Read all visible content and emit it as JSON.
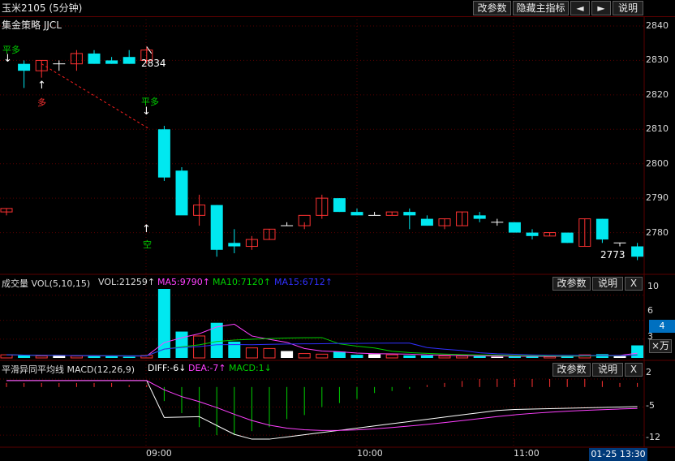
{
  "window": {
    "title": "玉米2105 (5分钟)",
    "buttons": {
      "change_params": "改参数",
      "hide_main": "隐藏主指标",
      "left": "◄",
      "right": "►",
      "help": "说明"
    }
  },
  "main_panel": {
    "strategy": "集金策略 JJCL",
    "y_ticks": [
      "2840",
      "2830",
      "2820",
      "2810",
      "2800",
      "2790",
      "2780"
    ],
    "annotations": {
      "sig1_label": "平多",
      "sig1_arrow": "↓",
      "sig2_label": "多",
      "sig2_arrow": "↑",
      "sig3_label": "平多",
      "sig3_arrow": "↓",
      "sig4_label": "空",
      "sig4_arrow": "↑",
      "high_price": "2834",
      "low_price": "2773"
    }
  },
  "volume_panel": {
    "title": "成交量 VOL(5,10,15)",
    "vol": "VOL:21259↑",
    "ma5": "MA5:9790↑",
    "ma10": "MA10:7120↑",
    "ma15": "MA15:6712↑",
    "y_ticks": [
      "10",
      "6",
      "3"
    ],
    "current": "4",
    "unit_btn": "×万",
    "buttons": {
      "change_params": "改参数",
      "help": "说明",
      "close": "X"
    }
  },
  "macd_panel": {
    "title": "平滑异同平均线 MACD(12,26,9)",
    "diff": "DIFF:-6↓",
    "dea": "DEA:-7↑",
    "macd": "MACD:1↓",
    "y_ticks": [
      "2",
      "-5",
      "-12"
    ],
    "buttons": {
      "change_params": "改参数",
      "help": "说明",
      "close": "X"
    }
  },
  "time_axis": {
    "labels": [
      "09:00",
      "10:00",
      "11:00"
    ],
    "current": "01-25 13:30"
  },
  "colors": {
    "up": "#ff3232",
    "down": "#00e8f0",
    "ma5": "#ff40ff",
    "ma10": "#00d000",
    "ma15": "#3030ff",
    "grid": "#5a0000"
  },
  "chart_data": [
    {
      "type": "candlestick",
      "title": "玉米2105 (5分钟)",
      "ylim": [
        2770,
        2843
      ],
      "candles": [
        {
          "o": 2786,
          "h": 2787,
          "l": 2785,
          "c": 2787
        },
        {
          "o": 2829,
          "h": 2830,
          "l": 2822,
          "c": 2827
        },
        {
          "o": 2827,
          "h": 2830,
          "l": 2825,
          "c": 2830
        },
        {
          "o": 2829,
          "h": 2830,
          "l": 2827,
          "c": 2829
        },
        {
          "o": 2829,
          "h": 2833,
          "l": 2827,
          "c": 2832
        },
        {
          "o": 2832,
          "h": 2833,
          "l": 2829,
          "c": 2829
        },
        {
          "o": 2830,
          "h": 2831,
          "l": 2829,
          "c": 2829
        },
        {
          "o": 2831,
          "h": 2833,
          "l": 2829,
          "c": 2829
        },
        {
          "o": 2830,
          "h": 2834,
          "l": 2829,
          "c": 2833
        },
        {
          "o": 2810,
          "h": 2811,
          "l": 2795,
          "c": 2796
        },
        {
          "o": 2798,
          "h": 2799,
          "l": 2786,
          "c": 2785
        },
        {
          "o": 2785,
          "h": 2791,
          "l": 2782,
          "c": 2788
        },
        {
          "o": 2788,
          "h": 2788,
          "l": 2773,
          "c": 2775
        },
        {
          "o": 2777,
          "h": 2781,
          "l": 2774,
          "c": 2776
        },
        {
          "o": 2776,
          "h": 2779,
          "l": 2775,
          "c": 2778
        },
        {
          "o": 2778,
          "h": 2781,
          "l": 2778,
          "c": 2781
        },
        {
          "o": 2782,
          "h": 2783,
          "l": 2782,
          "c": 2782
        },
        {
          "o": 2782,
          "h": 2783,
          "l": 2781,
          "c": 2785
        },
        {
          "o": 2785,
          "h": 2791,
          "l": 2784,
          "c": 2790
        },
        {
          "o": 2790,
          "h": 2790,
          "l": 2786,
          "c": 2786
        },
        {
          "o": 2786,
          "h": 2787,
          "l": 2785,
          "c": 2785
        },
        {
          "o": 2785,
          "h": 2786,
          "l": 2785,
          "c": 2785
        },
        {
          "o": 2785,
          "h": 2786,
          "l": 2785,
          "c": 2786
        },
        {
          "o": 2786,
          "h": 2787,
          "l": 2781,
          "c": 2785
        },
        {
          "o": 2784,
          "h": 2785,
          "l": 2782,
          "c": 2782
        },
        {
          "o": 2782,
          "h": 2784,
          "l": 2781,
          "c": 2784
        },
        {
          "o": 2782,
          "h": 2786,
          "l": 2782,
          "c": 2786
        },
        {
          "o": 2785,
          "h": 2786,
          "l": 2783,
          "c": 2784
        },
        {
          "o": 2783,
          "h": 2784,
          "l": 2782,
          "c": 2783
        },
        {
          "o": 2783,
          "h": 2783,
          "l": 2780,
          "c": 2780
        },
        {
          "o": 2780,
          "h": 2781,
          "l": 2778,
          "c": 2779
        },
        {
          "o": 2779,
          "h": 2780,
          "l": 2779,
          "c": 2780
        },
        {
          "o": 2780,
          "h": 2780,
          "l": 2777,
          "c": 2777
        },
        {
          "o": 2776,
          "h": 2784,
          "l": 2776,
          "c": 2784
        },
        {
          "o": 2784,
          "h": 2784,
          "l": 2777,
          "c": 2778
        },
        {
          "o": 2777,
          "h": 2777,
          "l": 2776,
          "c": 2777
        },
        {
          "o": 2776,
          "h": 2777,
          "l": 2772,
          "c": 2773
        }
      ]
    },
    {
      "type": "bar",
      "title": "成交量 VOL(5,10,15)",
      "ylim": [
        0,
        11
      ],
      "values": [
        0.5,
        0.4,
        0.3,
        0.4,
        0.3,
        0.3,
        0.3,
        0.2,
        0.4,
        11,
        4.2,
        3.5,
        5.6,
        2.6,
        1.6,
        1.5,
        1.1,
        0.7,
        0.6,
        1.0,
        0.5,
        0.6,
        0.5,
        0.4,
        0.4,
        0.3,
        0.3,
        0.3,
        0.2,
        0.3,
        0.2,
        0.2,
        0.4,
        0.5,
        0.6,
        0.3,
        2.0
      ]
    },
    {
      "type": "bar",
      "title": "平滑异同平均线 MACD(12,26,9)",
      "ylim": [
        -14,
        3
      ],
      "values": [
        1,
        1,
        1,
        1,
        1,
        1,
        1,
        0.5,
        0.5,
        -3.5,
        -6.5,
        -10,
        -12,
        -12,
        -11,
        -10,
        -8,
        -7,
        -5,
        -4,
        -3,
        -1.5,
        -1,
        -0.5,
        0.5,
        1,
        1.5,
        2,
        2,
        2,
        2,
        2,
        2,
        2,
        1.5,
        1,
        1
      ]
    }
  ]
}
